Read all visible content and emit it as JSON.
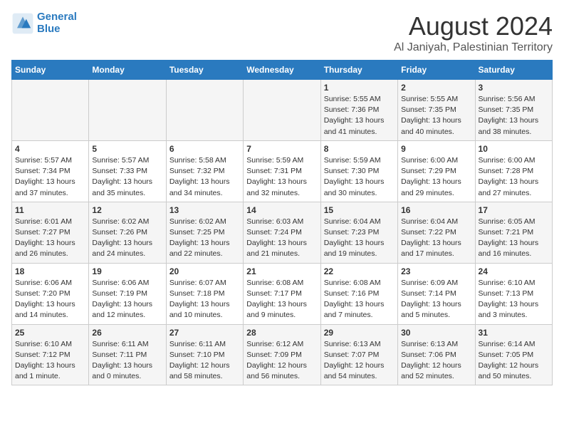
{
  "header": {
    "logo_line1": "General",
    "logo_line2": "Blue",
    "main_title": "August 2024",
    "sub_title": "Al Janiyah, Palestinian Territory"
  },
  "calendar": {
    "days_of_week": [
      "Sunday",
      "Monday",
      "Tuesday",
      "Wednesday",
      "Thursday",
      "Friday",
      "Saturday"
    ],
    "weeks": [
      [
        {
          "day": "",
          "content": ""
        },
        {
          "day": "",
          "content": ""
        },
        {
          "day": "",
          "content": ""
        },
        {
          "day": "",
          "content": ""
        },
        {
          "day": "1",
          "content": "Sunrise: 5:55 AM\nSunset: 7:36 PM\nDaylight: 13 hours\nand 41 minutes."
        },
        {
          "day": "2",
          "content": "Sunrise: 5:55 AM\nSunset: 7:35 PM\nDaylight: 13 hours\nand 40 minutes."
        },
        {
          "day": "3",
          "content": "Sunrise: 5:56 AM\nSunset: 7:35 PM\nDaylight: 13 hours\nand 38 minutes."
        }
      ],
      [
        {
          "day": "4",
          "content": "Sunrise: 5:57 AM\nSunset: 7:34 PM\nDaylight: 13 hours\nand 37 minutes."
        },
        {
          "day": "5",
          "content": "Sunrise: 5:57 AM\nSunset: 7:33 PM\nDaylight: 13 hours\nand 35 minutes."
        },
        {
          "day": "6",
          "content": "Sunrise: 5:58 AM\nSunset: 7:32 PM\nDaylight: 13 hours\nand 34 minutes."
        },
        {
          "day": "7",
          "content": "Sunrise: 5:59 AM\nSunset: 7:31 PM\nDaylight: 13 hours\nand 32 minutes."
        },
        {
          "day": "8",
          "content": "Sunrise: 5:59 AM\nSunset: 7:30 PM\nDaylight: 13 hours\nand 30 minutes."
        },
        {
          "day": "9",
          "content": "Sunrise: 6:00 AM\nSunset: 7:29 PM\nDaylight: 13 hours\nand 29 minutes."
        },
        {
          "day": "10",
          "content": "Sunrise: 6:00 AM\nSunset: 7:28 PM\nDaylight: 13 hours\nand 27 minutes."
        }
      ],
      [
        {
          "day": "11",
          "content": "Sunrise: 6:01 AM\nSunset: 7:27 PM\nDaylight: 13 hours\nand 26 minutes."
        },
        {
          "day": "12",
          "content": "Sunrise: 6:02 AM\nSunset: 7:26 PM\nDaylight: 13 hours\nand 24 minutes."
        },
        {
          "day": "13",
          "content": "Sunrise: 6:02 AM\nSunset: 7:25 PM\nDaylight: 13 hours\nand 22 minutes."
        },
        {
          "day": "14",
          "content": "Sunrise: 6:03 AM\nSunset: 7:24 PM\nDaylight: 13 hours\nand 21 minutes."
        },
        {
          "day": "15",
          "content": "Sunrise: 6:04 AM\nSunset: 7:23 PM\nDaylight: 13 hours\nand 19 minutes."
        },
        {
          "day": "16",
          "content": "Sunrise: 6:04 AM\nSunset: 7:22 PM\nDaylight: 13 hours\nand 17 minutes."
        },
        {
          "day": "17",
          "content": "Sunrise: 6:05 AM\nSunset: 7:21 PM\nDaylight: 13 hours\nand 16 minutes."
        }
      ],
      [
        {
          "day": "18",
          "content": "Sunrise: 6:06 AM\nSunset: 7:20 PM\nDaylight: 13 hours\nand 14 minutes."
        },
        {
          "day": "19",
          "content": "Sunrise: 6:06 AM\nSunset: 7:19 PM\nDaylight: 13 hours\nand 12 minutes."
        },
        {
          "day": "20",
          "content": "Sunrise: 6:07 AM\nSunset: 7:18 PM\nDaylight: 13 hours\nand 10 minutes."
        },
        {
          "day": "21",
          "content": "Sunrise: 6:08 AM\nSunset: 7:17 PM\nDaylight: 13 hours\nand 9 minutes."
        },
        {
          "day": "22",
          "content": "Sunrise: 6:08 AM\nSunset: 7:16 PM\nDaylight: 13 hours\nand 7 minutes."
        },
        {
          "day": "23",
          "content": "Sunrise: 6:09 AM\nSunset: 7:14 PM\nDaylight: 13 hours\nand 5 minutes."
        },
        {
          "day": "24",
          "content": "Sunrise: 6:10 AM\nSunset: 7:13 PM\nDaylight: 13 hours\nand 3 minutes."
        }
      ],
      [
        {
          "day": "25",
          "content": "Sunrise: 6:10 AM\nSunset: 7:12 PM\nDaylight: 13 hours\nand 1 minute."
        },
        {
          "day": "26",
          "content": "Sunrise: 6:11 AM\nSunset: 7:11 PM\nDaylight: 13 hours\nand 0 minutes."
        },
        {
          "day": "27",
          "content": "Sunrise: 6:11 AM\nSunset: 7:10 PM\nDaylight: 12 hours\nand 58 minutes."
        },
        {
          "day": "28",
          "content": "Sunrise: 6:12 AM\nSunset: 7:09 PM\nDaylight: 12 hours\nand 56 minutes."
        },
        {
          "day": "29",
          "content": "Sunrise: 6:13 AM\nSunset: 7:07 PM\nDaylight: 12 hours\nand 54 minutes."
        },
        {
          "day": "30",
          "content": "Sunrise: 6:13 AM\nSunset: 7:06 PM\nDaylight: 12 hours\nand 52 minutes."
        },
        {
          "day": "31",
          "content": "Sunrise: 6:14 AM\nSunset: 7:05 PM\nDaylight: 12 hours\nand 50 minutes."
        }
      ]
    ]
  }
}
